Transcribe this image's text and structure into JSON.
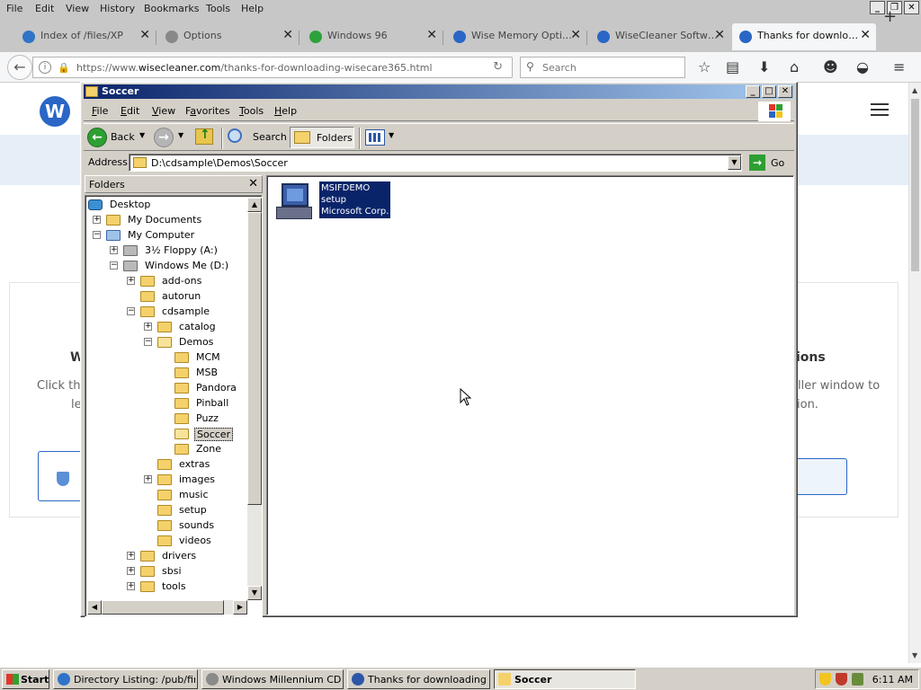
{
  "firefox": {
    "menu": [
      "File",
      "Edit",
      "View",
      "History",
      "Bookmarks",
      "Tools",
      "Help"
    ],
    "window_controls": [
      "_",
      "❐",
      "✕"
    ],
    "tabs": [
      {
        "label": "Index of /files/XP",
        "icon": "ie-icon",
        "icon_color": "#2f74c8",
        "active": false
      },
      {
        "label": "Options",
        "icon": "gear-icon",
        "icon_color": "#888888",
        "active": false
      },
      {
        "label": "Windows 96",
        "icon": "windows96-icon",
        "icon_color": "#2da13a",
        "active": false
      },
      {
        "label": "Wise Memory Opti…",
        "icon": "wise-icon",
        "icon_color": "#2a66c6",
        "active": false
      },
      {
        "label": "WiseCleaner Softw…",
        "icon": "wise-icon",
        "icon_color": "#2a66c6",
        "active": false
      },
      {
        "label": "Thanks for downlo…",
        "icon": "wise-icon",
        "icon_color": "#2a66c6",
        "active": true
      }
    ],
    "url_prefix": "https://www.",
    "url_domain": "wisecleaner.com",
    "url_path": "/thanks-for-downloading-wisecare365.html",
    "search_placeholder": "Search"
  },
  "page": {
    "heading_left": "W",
    "heading_right": "ions",
    "text_click": "Click the",
    "text_le": "le",
    "text_right1": "ller window to",
    "text_right2": "ion."
  },
  "explorer": {
    "title": "Soccer",
    "menu": [
      {
        "label": "File",
        "u": "F",
        "rest": "ile"
      },
      {
        "label": "Edit",
        "u": "E",
        "rest": "dit"
      },
      {
        "label": "View",
        "u": "V",
        "rest": "iew"
      },
      {
        "label": "Favorites",
        "u": "a",
        "pre": "F",
        "rest": "vorites"
      },
      {
        "label": "Tools",
        "u": "T",
        "rest": "ools"
      },
      {
        "label": "Help",
        "u": "H",
        "rest": "elp"
      }
    ],
    "toolbar": {
      "back": "Back",
      "search": "Search",
      "folders": "Folders"
    },
    "address_label": "Address",
    "address_value": "D:\\cdsample\\Demos\\Soccer",
    "go_label": "Go",
    "folders_header": "Folders",
    "tree": [
      {
        "label": "Desktop",
        "expander": "",
        "kind": "desk",
        "depth": 0
      },
      {
        "label": "My Documents",
        "expander": "+",
        "kind": "folder",
        "depth": 1
      },
      {
        "label": "My Computer",
        "expander": "−",
        "kind": "pc",
        "depth": 1
      },
      {
        "label": "3½ Floppy (A:)",
        "expander": "+",
        "kind": "drv",
        "depth": 2
      },
      {
        "label": "Windows Me (D:)",
        "expander": "−",
        "kind": "drv",
        "depth": 2
      },
      {
        "label": "add-ons",
        "expander": "+",
        "kind": "folder",
        "depth": 3
      },
      {
        "label": "autorun",
        "expander": "",
        "kind": "folder",
        "depth": 3
      },
      {
        "label": "cdsample",
        "expander": "−",
        "kind": "folder",
        "depth": 3
      },
      {
        "label": "catalog",
        "expander": "+",
        "kind": "folder",
        "depth": 4
      },
      {
        "label": "Demos",
        "expander": "−",
        "kind": "open",
        "depth": 4
      },
      {
        "label": "MCM",
        "expander": "",
        "kind": "folder",
        "depth": 5
      },
      {
        "label": "MSB",
        "expander": "",
        "kind": "folder",
        "depth": 5
      },
      {
        "label": "Pandora",
        "expander": "",
        "kind": "folder",
        "depth": 5
      },
      {
        "label": "Pinball",
        "expander": "",
        "kind": "folder",
        "depth": 5
      },
      {
        "label": "Puzz",
        "expander": "",
        "kind": "folder",
        "depth": 5
      },
      {
        "label": "Soccer",
        "expander": "",
        "kind": "open",
        "depth": 5,
        "selected": true
      },
      {
        "label": "Zone",
        "expander": "",
        "kind": "folder",
        "depth": 5
      },
      {
        "label": "extras",
        "expander": "",
        "kind": "folder",
        "depth": 4
      },
      {
        "label": "images",
        "expander": "+",
        "kind": "folder",
        "depth": 4
      },
      {
        "label": "music",
        "expander": "",
        "kind": "folder",
        "depth": 4
      },
      {
        "label": "setup",
        "expander": "",
        "kind": "folder",
        "depth": 4
      },
      {
        "label": "sounds",
        "expander": "",
        "kind": "folder",
        "depth": 4
      },
      {
        "label": "videos",
        "expander": "",
        "kind": "folder",
        "depth": 4
      },
      {
        "label": "drivers",
        "expander": "+",
        "kind": "folder",
        "depth": 3
      },
      {
        "label": "sbsi",
        "expander": "+",
        "kind": "folder",
        "depth": 3
      },
      {
        "label": "tools",
        "expander": "+",
        "kind": "folder",
        "depth": 3
      }
    ],
    "file": {
      "name": "MSIFDEMO",
      "type": "setup",
      "company": "Microsoft Corp."
    }
  },
  "taskbar": {
    "start": "Start",
    "tasks": [
      {
        "label": "Directory Listing: /pub/fir...",
        "icon": "ie-icon",
        "active": false
      },
      {
        "label": "Windows Millennium CD-...",
        "icon": "cd-icon",
        "active": false
      },
      {
        "label": "Thanks for downloading ...",
        "icon": "firefox-icon",
        "active": false
      },
      {
        "label": "Soccer",
        "icon": "folder-icon",
        "active": true
      }
    ],
    "clock": "6:11 AM"
  }
}
